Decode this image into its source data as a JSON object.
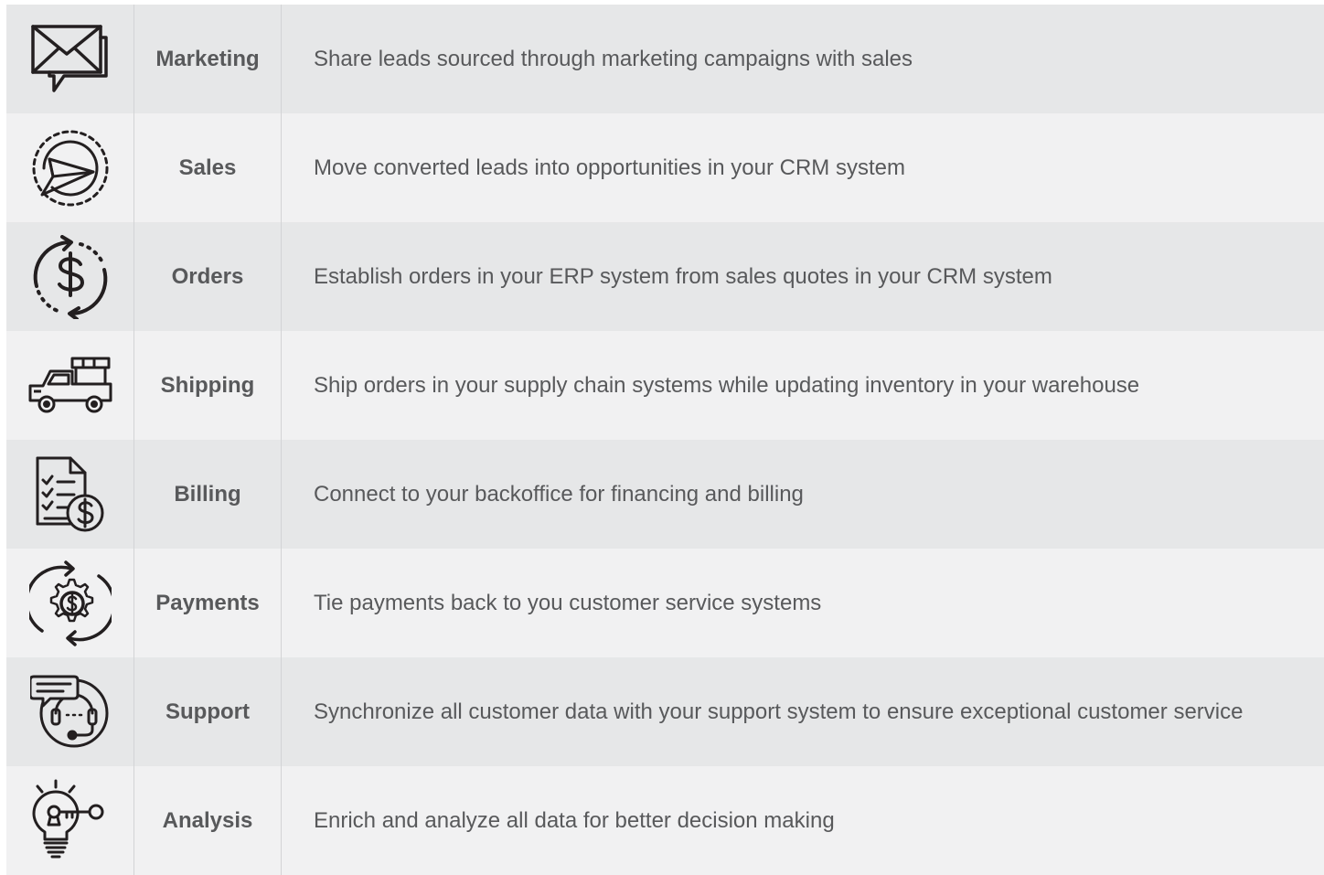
{
  "colors": {
    "row_dark": "#e6e7e8",
    "row_light": "#f1f1f2",
    "text": "#58595b",
    "icon": "#231f20"
  },
  "rows": [
    {
      "icon": "envelope-chat-icon",
      "name": "Marketing",
      "description": "Share leads sourced through marketing campaigns with sales"
    },
    {
      "icon": "paper-plane-circle-icon",
      "name": "Sales",
      "description": "Move converted leads into opportunities in your CRM system"
    },
    {
      "icon": "dollar-cycle-icon",
      "name": "Orders",
      "description": "Establish orders in your ERP system from sales quotes in your CRM system"
    },
    {
      "icon": "delivery-truck-icon",
      "name": "Shipping",
      "description": "Ship orders in your supply chain systems while updating inventory in your warehouse"
    },
    {
      "icon": "invoice-dollar-icon",
      "name": "Billing",
      "description": "Connect to your backoffice for financing and billing"
    },
    {
      "icon": "gear-dollar-cycle-icon",
      "name": "Payments",
      "description": "Tie payments back to you customer service systems"
    },
    {
      "icon": "headset-chat-icon",
      "name": "Support",
      "description": "Synchronize all customer data with your support system to ensure exceptional customer service"
    },
    {
      "icon": "lightbulb-key-icon",
      "name": "Analysis",
      "description": "Enrich and analyze all data for better decision making"
    }
  ]
}
